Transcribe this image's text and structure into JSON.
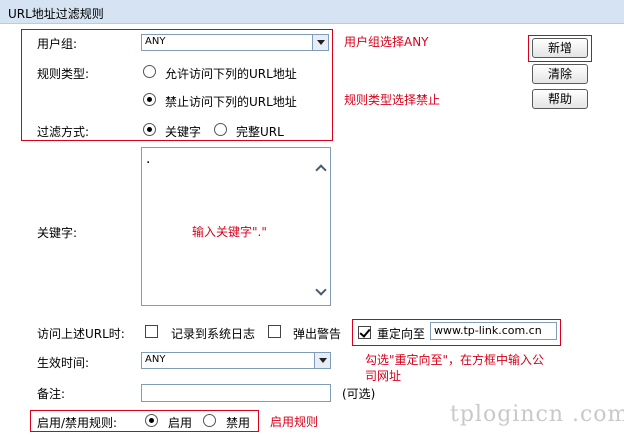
{
  "header": {
    "title": "URL地址过滤规则"
  },
  "form": {
    "user_group": {
      "label": "用户组:",
      "value": "ANY"
    },
    "rule_type": {
      "label": "规则类型:",
      "options": [
        "允许访问下列的URL地址",
        "禁止访问下列的URL地址"
      ],
      "selected": 1
    },
    "filter_mode": {
      "label": "过滤方式:",
      "options": [
        "关键字",
        "完整URL"
      ],
      "selected": 0
    },
    "keyword": {
      "label": "关键字:",
      "value": "."
    },
    "on_access": {
      "label": "访问上述URL时:",
      "log_label": "记录到系统日志",
      "log_checked": false,
      "popup_label": "弹出警告",
      "popup_checked": false,
      "redirect_label": "重定向至",
      "redirect_checked": true,
      "redirect_value": "www.tp-link.com.cn"
    },
    "effective_time": {
      "label": "生效时间:",
      "value": "ANY"
    },
    "remark": {
      "label": "备注:",
      "value": "",
      "hint": "(可选)"
    },
    "enable_rule": {
      "label": "启用/禁用规则:",
      "options": [
        "启用",
        "禁用"
      ],
      "selected": 0
    }
  },
  "buttons": {
    "add": "新增",
    "clear": "清除",
    "help": "帮助"
  },
  "annotations": {
    "user_group_note": "用户组选择ANY",
    "rule_type_note": "规则类型选择禁止",
    "keyword_note": "输入关键字\".\"",
    "redirect_note_line1": "勾选\"重定向至\"，在方框中输入公",
    "redirect_note_line2": "司网址",
    "enable_note": "启用规则"
  },
  "watermark": "tplogincn .com",
  "colors": {
    "annotation_red": "#d9001b",
    "title_bar": "#d5e3f2"
  }
}
